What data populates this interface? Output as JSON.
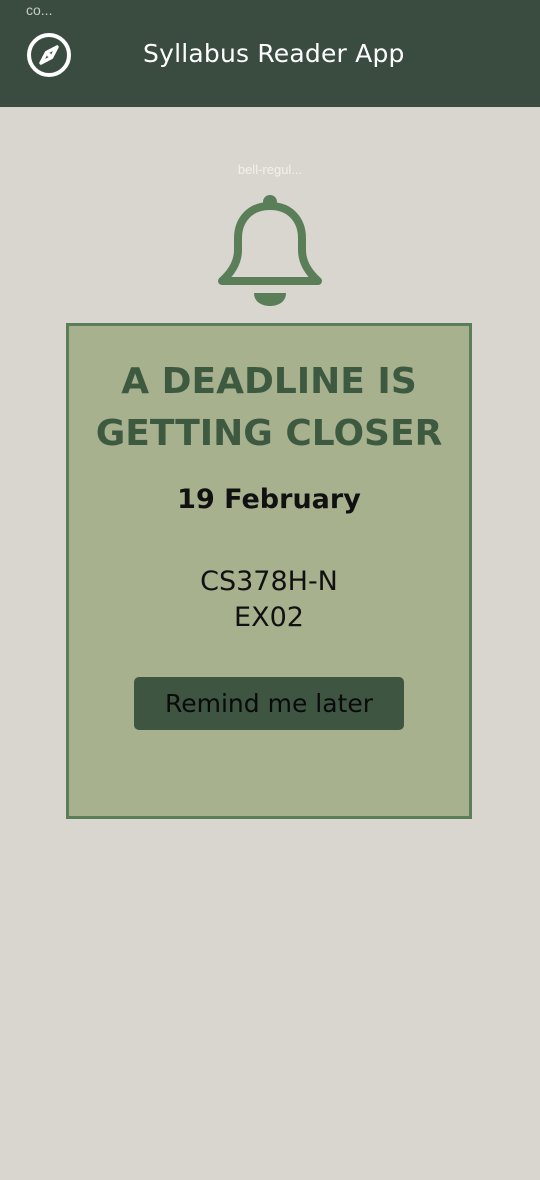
{
  "status": {
    "label": "co..."
  },
  "header": {
    "title": "Syllabus Reader App",
    "icon": "compass-icon"
  },
  "bell": {
    "tooltip": "bell-regul...",
    "icon": "bell-icon"
  },
  "card": {
    "heading_line1": "A DEADLINE IS",
    "heading_line2": "GETTING CLOSER",
    "date": "19 February",
    "course_line1": "CS378H-N",
    "course_line2": "EX02",
    "button_label": "Remind me later"
  },
  "colors": {
    "appbar": "#3a4c40",
    "background": "#d8d6ce",
    "card": "#a7b18e",
    "card_border": "#5a7f58",
    "accent": "#5a7f58",
    "button": "#3e5542"
  }
}
